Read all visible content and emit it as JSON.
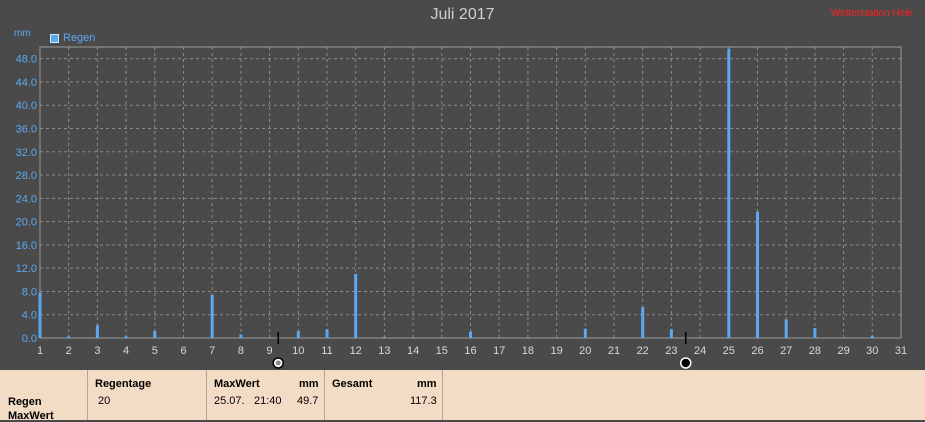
{
  "title": "Juli 2017",
  "watermark": "Wetterstation Hele",
  "unit_label": "mm",
  "legend": {
    "label": "Regen",
    "color": "#5aa9f0"
  },
  "chart_data": {
    "type": "bar",
    "title": "Juli 2017",
    "ylabel": "mm",
    "xlabel": "",
    "ylim": [
      0,
      50
    ],
    "yticks": [
      0.0,
      4.0,
      8.0,
      12.0,
      16.0,
      20.0,
      24.0,
      28.0,
      32.0,
      36.0,
      40.0,
      44.0,
      48.0
    ],
    "xlim": [
      1,
      31
    ],
    "xticks": [
      1,
      2,
      3,
      4,
      5,
      6,
      7,
      8,
      9,
      10,
      11,
      12,
      13,
      14,
      15,
      16,
      17,
      18,
      19,
      20,
      21,
      22,
      23,
      24,
      25,
      26,
      27,
      28,
      29,
      30,
      31
    ],
    "grid": true,
    "series": [
      {
        "name": "Regen",
        "color": "#5aa9f0",
        "x": [
          1,
          2,
          3,
          4,
          5,
          7,
          8,
          10,
          11,
          12,
          13,
          16,
          20,
          22,
          23,
          25,
          26,
          27,
          28,
          30
        ],
        "values": [
          7.8,
          0.3,
          2.2,
          0.3,
          1.2,
          7.4,
          0.6,
          1.2,
          1.5,
          11.0,
          0.2,
          1.1,
          1.6,
          5.3,
          1.5,
          49.7,
          21.7,
          3.2,
          1.7,
          0.4
        ]
      }
    ],
    "moon_markers": [
      {
        "x": 9.3,
        "icon": "full-moon-icon"
      },
      {
        "x": 23.5,
        "icon": "new-moon-icon"
      }
    ]
  },
  "stats": {
    "row_labels": [
      "Regen",
      "MaxWert"
    ],
    "regentage": {
      "header": "Regentage",
      "value": "20"
    },
    "maxwert": {
      "header": "MaxWert",
      "unit": "mm",
      "date": "25.07.",
      "time": "21:40",
      "value": "49.7"
    },
    "gesamt": {
      "header": "Gesamt",
      "unit": "mm",
      "value": "117.3"
    }
  }
}
